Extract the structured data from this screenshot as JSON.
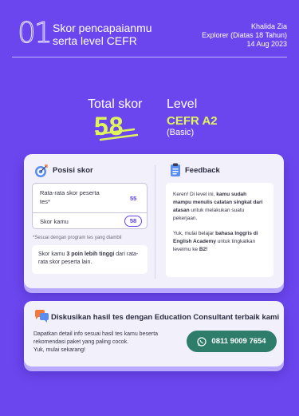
{
  "header": {
    "number": "01",
    "title_line1": "Skor pencapaianmu",
    "title_line2": "serta level CEFR",
    "user_name": "Khalida Zia",
    "user_category": "Explorer (Diatas 18 Tahun)",
    "date": "14 Aug 2023"
  },
  "score": {
    "total_label": "Total skor",
    "total_value": "58",
    "level_label": "Level",
    "level_value": "CEFR A2",
    "level_sub": "(Basic)"
  },
  "position": {
    "title": "Posisi skor",
    "avg_label": "Rata-rata skor peserta tes*",
    "avg_value": "55",
    "your_label": "Skor kamu",
    "your_value": "58",
    "footnote": "*Sesuai dengan program tes yang diambil",
    "compare_prefix": "Skor kamu ",
    "compare_bold": "3 poin lebih tinggi",
    "compare_suffix": " dari rata-rata skor peserta lain."
  },
  "feedback": {
    "title": "Feedback",
    "p1_prefix": "Keren! Di level ini, ",
    "p1_bold": "kamu sudah mampu menulis catatan singkat dari atasan",
    "p1_suffix": " untuk melakukan suatu pekerjaan.",
    "p2_prefix": "Yuk, mulai belajar ",
    "p2_bold": "bahasa Inggris di English Academy",
    "p2_mid": " untuk tingkatkan levelmu ke ",
    "p2_target": "B2!",
    "p2_suffix": ""
  },
  "cta": {
    "title": "Diskusikan hasil tes dengan Education Consultant terbaik kami",
    "desc_line1": "Dapatkan detail info sesuai hasil tes kamu beserta",
    "desc_line2": "rekomendasi paket yang paling cocok.",
    "desc_line3": "Yuk, mulai sekarang!",
    "phone": "0811 9009 7654"
  },
  "colors": {
    "background": "#6b46ee",
    "accent_yellow": "#e0f55a",
    "card": "#f2f0fa",
    "whatsapp_button": "#2e7d6b"
  },
  "icons": {
    "position": "target-icon",
    "feedback": "clipboard-icon",
    "cta": "chat-bubbles-icon",
    "phone": "whatsapp-icon"
  }
}
